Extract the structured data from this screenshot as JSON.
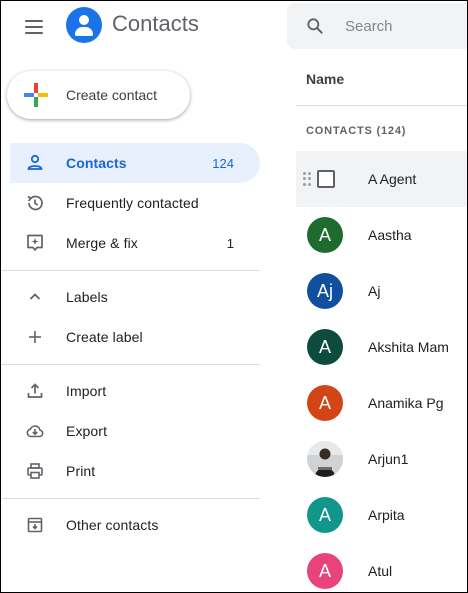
{
  "header": {
    "app_title": "Contacts",
    "search_placeholder": "Search"
  },
  "sidebar": {
    "create_label": "Create contact",
    "items": [
      {
        "id": "contacts",
        "label": "Contacts",
        "count": "124",
        "icon": "person-icon"
      },
      {
        "id": "frequent",
        "label": "Frequently contacted",
        "count": "",
        "icon": "history-icon"
      },
      {
        "id": "merge",
        "label": "Merge & fix",
        "count": "1",
        "icon": "merge-fix-icon"
      },
      {
        "id": "labels",
        "label": "Labels",
        "count": "",
        "icon": "chevron-up-icon"
      },
      {
        "id": "create-label",
        "label": "Create label",
        "count": "",
        "icon": "plus-icon"
      },
      {
        "id": "import",
        "label": "Import",
        "count": "",
        "icon": "upload-icon"
      },
      {
        "id": "export",
        "label": "Export",
        "count": "",
        "icon": "cloud-download-icon"
      },
      {
        "id": "print",
        "label": "Print",
        "count": "",
        "icon": "printer-icon"
      },
      {
        "id": "other",
        "label": "Other contacts",
        "count": "",
        "icon": "archive-icon"
      }
    ]
  },
  "list": {
    "column_header": "Name",
    "section_header": "CONTACTS (124)",
    "contacts": [
      {
        "name": "A Agent",
        "initial": "",
        "color": ""
      },
      {
        "name": "Aastha",
        "initial": "A",
        "color": "#1e6a2f"
      },
      {
        "name": "Aj",
        "initial": "Aj",
        "color": "#0f4f9e"
      },
      {
        "name": "Akshita Mam",
        "initial": "A",
        "color": "#0c4b3d"
      },
      {
        "name": "Anamika Pg",
        "initial": "A",
        "color": "#d24516"
      },
      {
        "name": "Arjun1",
        "initial": "",
        "color": ""
      },
      {
        "name": "Arpita",
        "initial": "A",
        "color": "#12958a"
      },
      {
        "name": "Atul",
        "initial": "A",
        "color": "#e8437a"
      }
    ]
  },
  "colors": {
    "accent": "#1a73e8",
    "active_bg": "#e8f0fe",
    "active_text": "#1967d2"
  }
}
